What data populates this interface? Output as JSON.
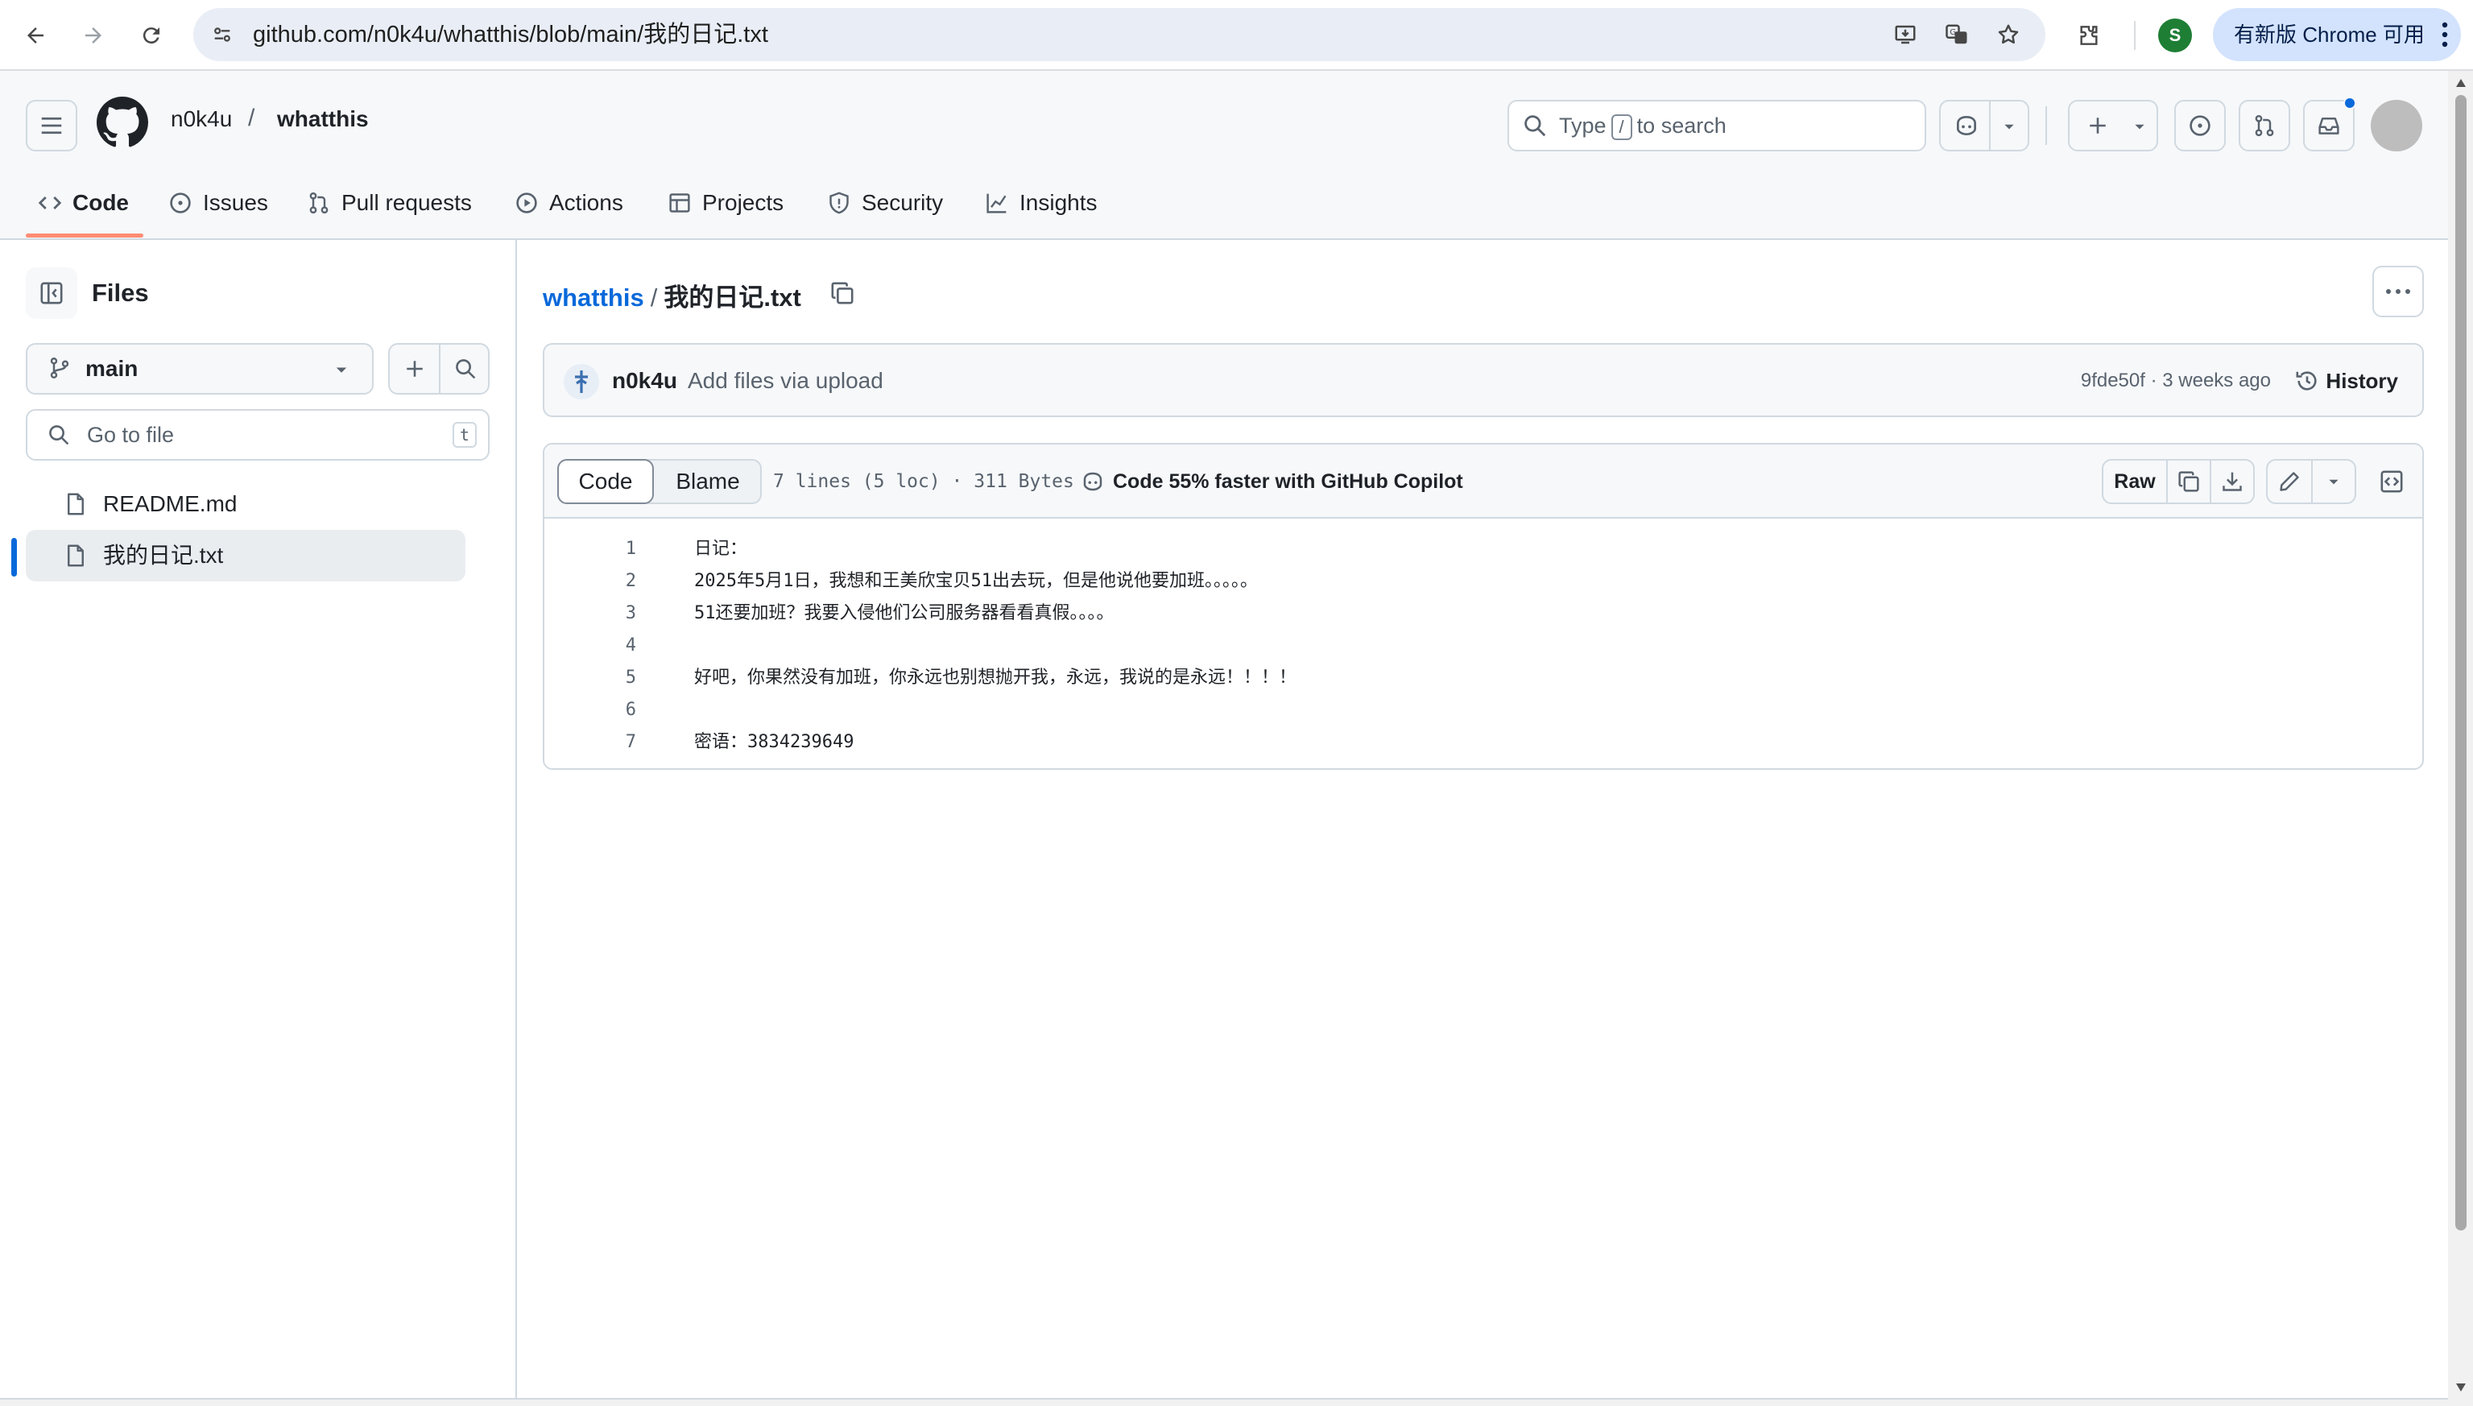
{
  "browser": {
    "url": "github.com/n0k4u/whatthis/blob/main/我的日记.txt",
    "profile_initial": "S",
    "update_label": "有新版 Chrome 可用"
  },
  "header": {
    "owner": "n0k4u",
    "separator": "/",
    "repo": "whatthis",
    "search_type": "Type",
    "search_key": "/",
    "search_rest": "to search"
  },
  "nav": {
    "tabs": [
      {
        "label": "Code"
      },
      {
        "label": "Issues"
      },
      {
        "label": "Pull requests"
      },
      {
        "label": "Actions"
      },
      {
        "label": "Projects"
      },
      {
        "label": "Security"
      },
      {
        "label": "Insights"
      }
    ]
  },
  "sidebar": {
    "title": "Files",
    "branch": "main",
    "goto_placeholder": "Go to file",
    "goto_key": "t",
    "files": [
      {
        "name": "README.md"
      },
      {
        "name": "我的日记.txt"
      }
    ]
  },
  "breadcrumb": {
    "repo": "whatthis",
    "separator": "/",
    "file": "我的日记.txt"
  },
  "commit": {
    "author": "n0k4u",
    "message": "Add files via upload",
    "sha_age": "9fde50f · 3 weeks ago",
    "history_label": "History"
  },
  "file": {
    "tab_code": "Code",
    "tab_blame": "Blame",
    "info": "7 lines (5 loc) · 311 Bytes",
    "copilot": "Code 55% faster with GitHub Copilot",
    "raw_label": "Raw",
    "lines": [
      {
        "n": "1",
        "text": "日记："
      },
      {
        "n": "2",
        "text": "2025年5月1日，我想和王美欣宝贝51出去玩，但是他说他要加班。。。。。"
      },
      {
        "n": "3",
        "text": "51还要加班？我要入侵他们公司服务器看看真假。。。。"
      },
      {
        "n": "4",
        "text": ""
      },
      {
        "n": "5",
        "text": "好吧，你果然没有加班，你永远也别想抛开我，永远，我说的是永远！！！！"
      },
      {
        "n": "6",
        "text": ""
      },
      {
        "n": "7",
        "text": "密语：3834239649"
      }
    ]
  },
  "colors": {
    "accent": "#0969da",
    "tab_underline": "#fd8c73",
    "border": "#d1d9e0"
  }
}
